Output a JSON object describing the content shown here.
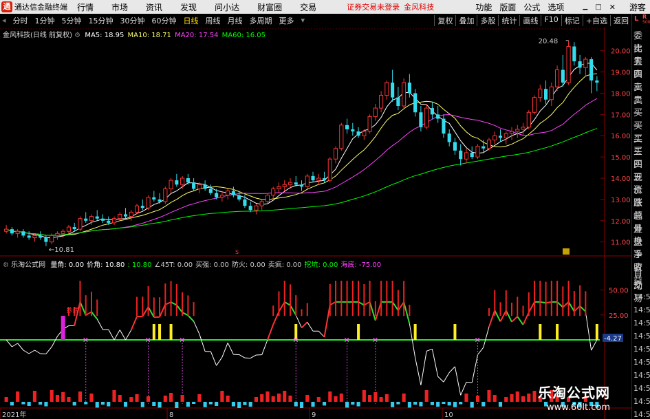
{
  "topbar": {
    "app_name": "通达信金融终端",
    "menus": [
      "行情",
      "市场",
      "资讯",
      "发现",
      "问小达",
      "财富圈",
      "交易"
    ],
    "warning": "证券交易未登录",
    "stock_name": "金风科技",
    "right_menus": [
      "功能",
      "版面",
      "公式",
      "选项"
    ],
    "guest": "游客"
  },
  "toolbar": {
    "periods": [
      "分时",
      "1分钟",
      "5分钟",
      "15分钟",
      "30分钟",
      "60分钟",
      "日线",
      "周线",
      "月线",
      "多周期",
      "更多"
    ],
    "active_period": "日线",
    "buttons": [
      "复权",
      "叠加",
      "多股",
      "统计",
      "画线",
      "F10",
      "标记",
      "+自选",
      "返回"
    ]
  },
  "main_header": {
    "title": "金风科技(日线 前复权)",
    "ma5": "MA5: 18.95",
    "ma10": "MA10: 18.71",
    "ma20": "MA20: 17.54",
    "ma60": "MA60: 16.05"
  },
  "price_axis": [
    "20.00",
    "19.00",
    "18.00",
    "17.00",
    "16.00",
    "15.00",
    "14.00",
    "13.00",
    "12.00",
    "11.00"
  ],
  "annotations": {
    "high": "20.48",
    "low": "10.81"
  },
  "sub_header": {
    "title": "乐淘公式网",
    "items": [
      {
        "text": "量角: 0.00",
        "color": "#ffffff"
      },
      {
        "text": "价角: 10.80",
        "color": "#ffffff"
      },
      {
        "text": ": 10.80",
        "color": "#00ff00"
      },
      {
        "text": "∠45T: 0.00",
        "color": "#cccccc"
      },
      {
        "text": "买强: 0.00",
        "color": "#cccccc"
      },
      {
        "text": "防火: 0.00",
        "color": "#cccccc"
      },
      {
        "text": "卖疯: 0.00",
        "color": "#cccccc"
      },
      {
        "text": "挖坑: 0.00",
        "color": "#00ff00"
      },
      {
        "text": "海底: -75.00",
        "color": "#ff44ff"
      }
    ]
  },
  "sub_axis": [
    "50.00",
    "25.00"
  ],
  "sub_value": "-4.27",
  "date_axis": [
    "2021年",
    "8",
    "9",
    "10"
  ],
  "right_panel": {
    "header": "L R 500",
    "top_labels": [
      "委比",
      "卖五",
      "卖四",
      "卖三",
      "卖二",
      "卖一",
      "买一",
      "买二",
      "买三",
      "买四",
      "买五",
      "现价",
      "涨跌",
      "涨幅",
      "总量",
      "外盘",
      "换手",
      "净资",
      "收益"
    ],
    "bottom_labels": [
      "自动",
      "交易"
    ],
    "times": [
      "14:56",
      "14:56",
      "14:56",
      "14:56",
      "14:56",
      "14:56",
      "14:56",
      "14:56",
      "14:56",
      "14:56"
    ]
  },
  "small_label": "抄底",
  "watermark": {
    "title": "乐淘公式网",
    "url": "www.60lt.com"
  },
  "chart_data": {
    "type": "candlestick",
    "price_range": [
      10.6,
      20.8
    ],
    "candles": [
      [
        11.5,
        11.8,
        11.4,
        11.6
      ],
      [
        11.6,
        11.7,
        11.3,
        11.4
      ],
      [
        11.4,
        11.6,
        11.2,
        11.5
      ],
      [
        11.5,
        11.6,
        11.2,
        11.3
      ],
      [
        11.3,
        11.5,
        11.1,
        11.2
      ],
      [
        11.2,
        11.4,
        11.0,
        11.3
      ],
      [
        11.3,
        11.5,
        11.1,
        11.2
      ],
      [
        11.2,
        11.3,
        10.8,
        11.0
      ],
      [
        11.0,
        11.4,
        10.9,
        11.3
      ],
      [
        11.3,
        11.5,
        11.1,
        11.4
      ],
      [
        11.4,
        11.6,
        11.2,
        11.5
      ],
      [
        11.5,
        11.8,
        11.4,
        11.7
      ],
      [
        11.7,
        11.9,
        11.5,
        11.6
      ],
      [
        11.6,
        12.2,
        11.5,
        12.1
      ],
      [
        12.1,
        12.4,
        11.9,
        12.0
      ],
      [
        12.0,
        12.3,
        11.8,
        12.2
      ],
      [
        12.2,
        12.5,
        12.0,
        12.1
      ],
      [
        12.1,
        12.3,
        11.9,
        12.0
      ],
      [
        12.0,
        12.2,
        11.8,
        11.9
      ],
      [
        11.9,
        12.2,
        11.8,
        12.1
      ],
      [
        12.1,
        12.4,
        12.0,
        12.3
      ],
      [
        12.3,
        12.6,
        12.1,
        12.2
      ],
      [
        12.2,
        12.5,
        12.0,
        12.4
      ],
      [
        12.4,
        12.8,
        12.3,
        12.7
      ],
      [
        12.7,
        13.0,
        12.5,
        12.6
      ],
      [
        12.6,
        13.2,
        12.5,
        13.1
      ],
      [
        13.1,
        13.4,
        12.9,
        13.0
      ],
      [
        13.0,
        13.3,
        12.8,
        12.9
      ],
      [
        12.9,
        13.6,
        12.8,
        13.5
      ],
      [
        13.5,
        14.0,
        13.3,
        13.9
      ],
      [
        13.9,
        14.2,
        13.6,
        13.7
      ],
      [
        13.7,
        14.1,
        13.5,
        14.0
      ],
      [
        14.0,
        14.2,
        13.7,
        13.8
      ],
      [
        13.8,
        14.0,
        13.4,
        13.5
      ],
      [
        13.5,
        13.8,
        13.3,
        13.7
      ],
      [
        13.7,
        13.9,
        13.4,
        13.5
      ],
      [
        13.5,
        13.7,
        13.2,
        13.3
      ],
      [
        13.3,
        13.5,
        13.0,
        13.1
      ],
      [
        13.1,
        13.4,
        12.9,
        13.2
      ],
      [
        13.2,
        13.5,
        13.0,
        13.4
      ],
      [
        13.4,
        13.6,
        13.1,
        13.2
      ],
      [
        13.2,
        13.4,
        12.9,
        13.0
      ],
      [
        13.0,
        13.2,
        12.6,
        12.7
      ],
      [
        12.7,
        12.9,
        12.4,
        12.5
      ],
      [
        12.5,
        12.8,
        12.3,
        12.7
      ],
      [
        12.7,
        13.0,
        12.5,
        12.9
      ],
      [
        12.9,
        13.3,
        12.8,
        13.2
      ],
      [
        13.2,
        13.6,
        13.0,
        13.5
      ],
      [
        13.5,
        13.8,
        13.3,
        13.6
      ],
      [
        13.6,
        13.9,
        13.4,
        13.7
      ],
      [
        13.7,
        14.0,
        13.5,
        13.8
      ],
      [
        13.8,
        14.1,
        13.6,
        13.7
      ],
      [
        13.7,
        13.9,
        13.4,
        13.6
      ],
      [
        13.6,
        14.2,
        13.5,
        14.1
      ],
      [
        14.1,
        14.3,
        13.8,
        13.9
      ],
      [
        13.9,
        14.2,
        13.7,
        14.0
      ],
      [
        14.0,
        14.3,
        13.8,
        13.9
      ],
      [
        13.9,
        15.0,
        13.8,
        14.9
      ],
      [
        14.9,
        15.5,
        14.7,
        15.4
      ],
      [
        15.4,
        16.6,
        15.3,
        16.5
      ],
      [
        16.5,
        16.8,
        16.1,
        16.3
      ],
      [
        16.3,
        16.6,
        16.0,
        16.2
      ],
      [
        16.2,
        16.4,
        15.9,
        16.0
      ],
      [
        16.0,
        16.3,
        15.8,
        16.2
      ],
      [
        16.2,
        17.0,
        16.1,
        16.9
      ],
      [
        16.9,
        17.5,
        16.7,
        17.3
      ],
      [
        17.3,
        18.1,
        17.1,
        17.9
      ],
      [
        17.9,
        18.6,
        17.7,
        18.5
      ],
      [
        18.5,
        19.1,
        17.6,
        17.8
      ],
      [
        17.8,
        18.3,
        17.2,
        17.4
      ],
      [
        17.4,
        18.7,
        17.3,
        18.5
      ],
      [
        18.5,
        18.9,
        17.8,
        18.0
      ],
      [
        18.0,
        18.2,
        16.9,
        17.1
      ],
      [
        17.1,
        17.4,
        16.2,
        16.4
      ],
      [
        16.4,
        17.5,
        16.3,
        17.3
      ],
      [
        17.3,
        17.6,
        16.8,
        17.0
      ],
      [
        17.0,
        17.4,
        16.6,
        16.8
      ],
      [
        16.8,
        17.0,
        15.9,
        16.1
      ],
      [
        16.1,
        16.3,
        15.5,
        15.7
      ],
      [
        15.7,
        15.9,
        15.1,
        15.3
      ],
      [
        15.3,
        15.6,
        14.6,
        14.9
      ],
      [
        14.9,
        15.4,
        14.7,
        15.2
      ],
      [
        15.2,
        15.5,
        14.9,
        15.0
      ],
      [
        15.0,
        15.6,
        14.9,
        15.5
      ],
      [
        15.5,
        15.8,
        15.2,
        15.4
      ],
      [
        15.4,
        15.9,
        15.3,
        15.8
      ],
      [
        15.8,
        16.2,
        15.6,
        16.0
      ],
      [
        16.0,
        16.3,
        15.7,
        15.9
      ],
      [
        15.9,
        16.2,
        15.6,
        16.1
      ],
      [
        16.1,
        16.4,
        15.8,
        16.2
      ],
      [
        16.2,
        16.5,
        15.9,
        16.3
      ],
      [
        16.3,
        16.6,
        16.0,
        16.4
      ],
      [
        16.4,
        17.2,
        16.3,
        17.1
      ],
      [
        17.1,
        17.9,
        17.0,
        17.8
      ],
      [
        17.8,
        18.4,
        17.6,
        18.2
      ],
      [
        18.2,
        18.6,
        17.5,
        17.7
      ],
      [
        17.7,
        18.5,
        17.4,
        18.3
      ],
      [
        18.3,
        19.3,
        18.1,
        19.1
      ],
      [
        19.1,
        19.8,
        18.3,
        18.5
      ],
      [
        18.5,
        20.48,
        18.4,
        20.2
      ],
      [
        20.2,
        20.4,
        19.3,
        19.5
      ],
      [
        19.5,
        19.8,
        18.9,
        19.2
      ],
      [
        19.2,
        19.7,
        18.8,
        19.6
      ],
      [
        19.6,
        19.7,
        18.0,
        18.6
      ],
      [
        18.6,
        18.8,
        18.1,
        18.5
      ]
    ],
    "ma_series": [
      "MA5",
      "MA10",
      "MA20",
      "MA60"
    ]
  }
}
